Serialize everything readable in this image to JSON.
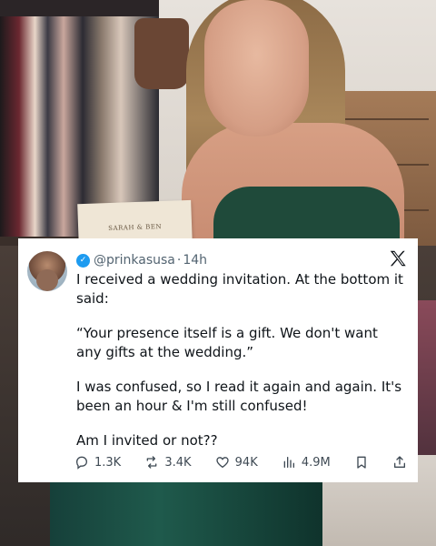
{
  "tweet": {
    "handle": "@prinkasusa",
    "separator": "·",
    "time": "14h",
    "paragraphs": [
      "I received a wedding invitation. At the bottom it said:",
      "“Your presence itself is a gift. We don't want any gifts at the wedding.”",
      "I was confused, so I read it again and again. It's been an hour & I'm still confused!",
      "Am I invited or not??"
    ],
    "actions": {
      "replies": "1.3K",
      "retweets": "3.4K",
      "likes": "94K",
      "views": "4.9M"
    }
  },
  "background": {
    "invitation_text": "SARAH & BEN"
  },
  "icons": {
    "verified": "verified-badge-icon",
    "platform": "x-logo-icon",
    "reply": "reply-icon",
    "retweet": "retweet-icon",
    "like": "heart-icon",
    "views": "bar-chart-icon",
    "bookmark": "bookmark-icon",
    "share": "share-icon"
  },
  "colors": {
    "verified": "#1d9bf0",
    "text": "#0f1419",
    "secondary": "#536471"
  }
}
